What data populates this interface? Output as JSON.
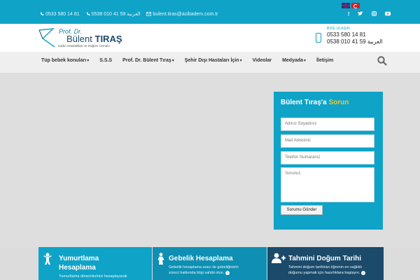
{
  "topbar": {
    "phone1": "0533 580 14 81",
    "phone2": "0538 010 41 59 العربية",
    "email": "bulent.tiras@acibadem.com.tr",
    "social_icons": [
      "facebook-icon",
      "twitter-icon",
      "instagram-icon",
      "youtube-icon"
    ],
    "flags": [
      "english-flag",
      "turkish-flag"
    ]
  },
  "logo": {
    "line1": "Prof. Dr.",
    "name_light": "Bülent",
    "name_bold": "TIRAŞ",
    "tagline": "Kadın Hastalıkları ve Doğum Uzmanı"
  },
  "call": {
    "label": "BİZE ULAŞIN",
    "number1": "0533 580 14 81",
    "number2": "0538 010 41 59 العربية"
  },
  "nav": {
    "items": [
      {
        "label": "Tüp bebek konuları",
        "caret": "▾"
      },
      {
        "label": "S.S.S",
        "caret": ""
      },
      {
        "label": "Prof. Dr. Bülent Tıraş",
        "caret": "▾"
      },
      {
        "label": "Şehir Dışı Hastaları İçin",
        "caret": "▾"
      },
      {
        "label": "Videolar",
        "caret": ""
      },
      {
        "label": "Medyada",
        "caret": "▾"
      },
      {
        "label": "İletişim",
        "caret": ""
      }
    ]
  },
  "form": {
    "title_main": "Bülent Tıraş'a",
    "title_highlight": "Sorun",
    "name_placeholder": "Adınız Soyadınız",
    "mail_placeholder": "Mail Adresiniz",
    "phone_placeholder": "Telefon Numaranız",
    "question_placeholder": "Sorunuz",
    "submit_label": "Sorumu Gönder"
  },
  "tiles": [
    {
      "title_line1": "Yumurtlama",
      "title_line2": "Hesaplama",
      "desc1": "Yumurtlama dönemlerinizi hesaplayarak",
      "desc2": ""
    },
    {
      "title_line1": "Gebelik Hesaplama",
      "title_line2": "",
      "desc1": "Gebelik hesaplama aracı ile gebeliğinizin",
      "desc2": "süreci hakkında bilgi sahibi olun."
    },
    {
      "title_line1": "Tahmini Doğum Tarihi",
      "title_line2": "",
      "desc1": "Tahmini doğum tarihinizi öğrenin en sağlıklı",
      "desc2": "doğumu yapmak için hazırlıklara başlayın."
    }
  ],
  "colors": {
    "accent": "#0fa3c8",
    "dark": "#1b4a6a",
    "highlight": "#f4c430"
  }
}
